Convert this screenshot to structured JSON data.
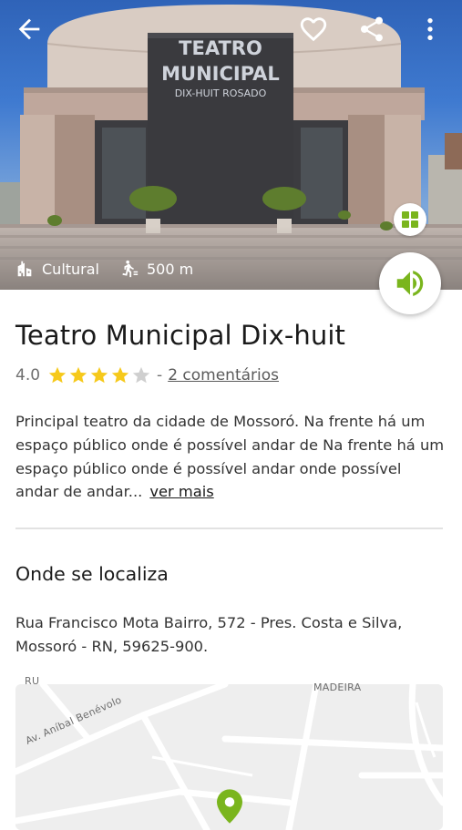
{
  "hero": {
    "facade_sign": {
      "line1": "TEATRO",
      "line2": "MUNICIPAL",
      "line3": "DIX-HUIT ROSADO"
    },
    "category": "Cultural",
    "distance": "500 m",
    "icons": {
      "back": "arrow-left-icon",
      "favorite": "heart-outline-icon",
      "share": "share-icon",
      "more": "more-vertical-icon",
      "gallery": "grid-icon",
      "audio": "volume-icon",
      "category": "building-icon",
      "distance": "walking-person-icon"
    }
  },
  "place": {
    "title": "Teatro Municipal Dix-huit",
    "rating": "4.0",
    "rating_stars": 4,
    "rating_max": 5,
    "separator": "-",
    "comments_link": "2 comentários",
    "description": "Principal teatro da cidade de Mossoró. Na frente há um espaço público onde é possível andar de Na frente há um espaço público onde é possível andar onde possível andar de andar...",
    "read_more": "ver mais"
  },
  "location": {
    "section_title": "Onde se localiza",
    "address": "Rua Francisco Mota Bairro, 572 - Pres. Costa e Silva, Mossoró - RN, 59625-900."
  },
  "map": {
    "labels": {
      "neighborhood": "MADEIRA",
      "street": "Av. Aníbal Benévolo",
      "partial": "RU"
    },
    "pin_icon": "map-pin-icon"
  },
  "colors": {
    "accent": "#7ab51d",
    "star_filled": "#f6c91b",
    "star_empty": "#cfcfcf"
  }
}
